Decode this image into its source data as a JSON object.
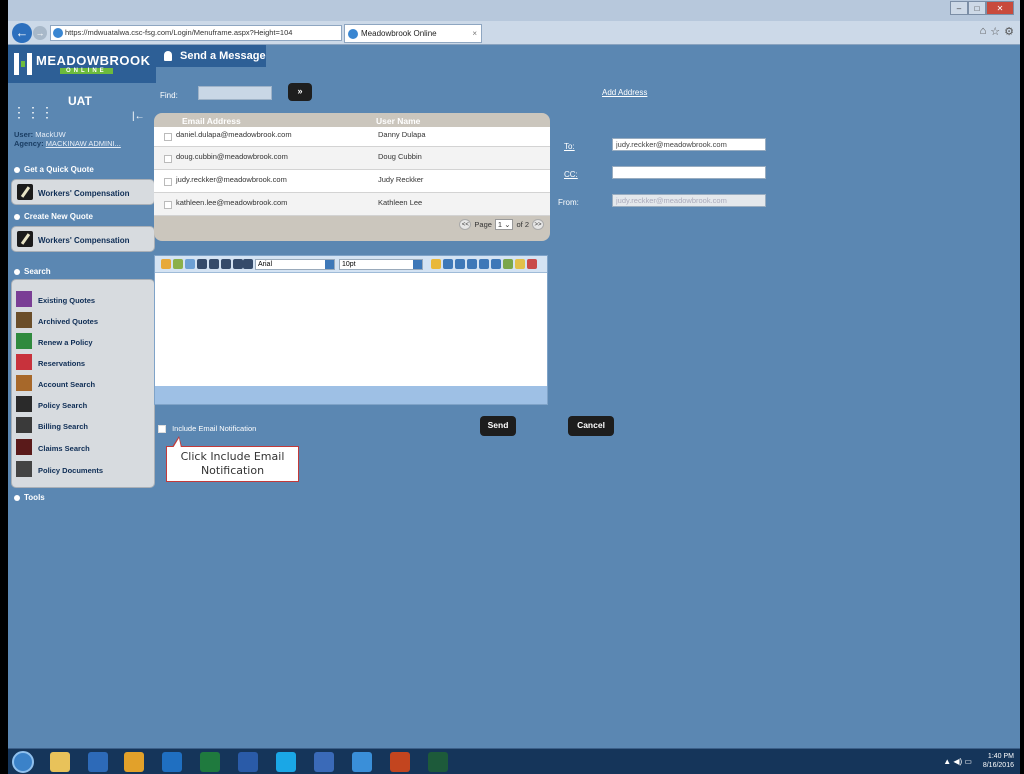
{
  "browser": {
    "window_title": "",
    "address": "https://mdwuatalwa.csc-fsg.com/Login/Menuframe.aspx?Height=104",
    "tab_title": "Meadowbrook Online",
    "tab_close": "×",
    "back": "←",
    "forward": "→",
    "minimize": "–",
    "maximize": "□",
    "close": "✕",
    "toolbar_icons": [
      "⌂",
      "☆",
      "⚙"
    ]
  },
  "app": {
    "logo_name": "MEADOWBROOK",
    "logo_tag": "ONLINE",
    "page_header": "Send a Message"
  },
  "sidebar": {
    "env": "UAT",
    "grid_glyph": "⋮⋮⋮",
    "pin_glyph": "|←",
    "user_label": "User:",
    "user_value": "MackUW",
    "agency_label": "Agency:",
    "agency_value": "MACKINAW ADMINI...",
    "get_quick_quote": "Get a Quick Quote",
    "quick_quote_item": "Workers' Compensation",
    "create_new_quote": "Create New Quote",
    "new_quote_item": "Workers' Compensation",
    "search": "Search",
    "search_items": [
      {
        "label": "Existing Quotes",
        "color": "#7a3e95"
      },
      {
        "label": "Archived Quotes",
        "color": "#6b4e2a"
      },
      {
        "label": "Renew a Policy",
        "color": "#2f8a3e"
      },
      {
        "label": "Reservations",
        "color": "#c8323c"
      },
      {
        "label": "Account Search",
        "color": "#a7682a"
      },
      {
        "label": "Policy Search",
        "color": "#2a2a2a"
      },
      {
        "label": "Billing Search",
        "color": "#3a3a3a"
      },
      {
        "label": "Claims Search",
        "color": "#5a1a1a"
      },
      {
        "label": "Policy Documents",
        "color": "#444444"
      }
    ],
    "tools": "Tools"
  },
  "main": {
    "find_label": "Find:",
    "find_value": "",
    "go_button": "»",
    "add_address": "Add Address",
    "contacts": {
      "col_email": "Email Address",
      "col_user": "User Name",
      "rows": [
        {
          "email": "daniel.dulapa@meadowbrook.com",
          "user": "Danny Dulapa"
        },
        {
          "email": "doug.cubbin@meadowbrook.com",
          "user": "Doug Cubbin"
        },
        {
          "email": "judy.reckker@meadowbrook.com",
          "user": "Judy Reckker"
        },
        {
          "email": "kathleen.lee@meadowbrook.com",
          "user": "Kathleen Lee"
        }
      ],
      "pager_prev": "<<",
      "pager_label": "Page",
      "pager_value": "1",
      "pager_of": "of 2",
      "pager_next": ">>"
    },
    "to_label": "To:",
    "to_value": "judy.reckker@meadowbrook.com",
    "cc_label": "CC:",
    "cc_value": "",
    "from_label": "From:",
    "from_value": "judy.reckker@meadowbrook.com",
    "editor": {
      "font": "Arial",
      "size": "10pt"
    },
    "include_notification": "Include Email Notification",
    "send": "Send",
    "cancel": "Cancel",
    "callout": "Click Include Email Notification"
  },
  "taskbar": {
    "time": "1:40 PM",
    "date": "8/16/2016",
    "tray_icons": "▲ ◀) ▭",
    "apps": [
      {
        "name": "file-explorer",
        "color": "#e8c25a"
      },
      {
        "name": "media",
        "color": "#2d6ab8"
      },
      {
        "name": "chrome",
        "color": "#e2a12a"
      },
      {
        "name": "outlook",
        "color": "#1f6fc1"
      },
      {
        "name": "excel",
        "color": "#1f7a3e"
      },
      {
        "name": "word",
        "color": "#2a5ba8"
      },
      {
        "name": "skype",
        "color": "#1aa7e6"
      },
      {
        "name": "visio",
        "color": "#3a6ab8"
      },
      {
        "name": "internet-explorer",
        "color": "#3a8fd9"
      },
      {
        "name": "powerpoint",
        "color": "#c3451f"
      },
      {
        "name": "captivate",
        "color": "#1d5a3a"
      }
    ]
  },
  "colors": {
    "page_bg": "#5b87b2",
    "header_dark": "#2d5f96",
    "logo_green": "#6dbb3c",
    "button_dark": "#1d1d1d"
  }
}
